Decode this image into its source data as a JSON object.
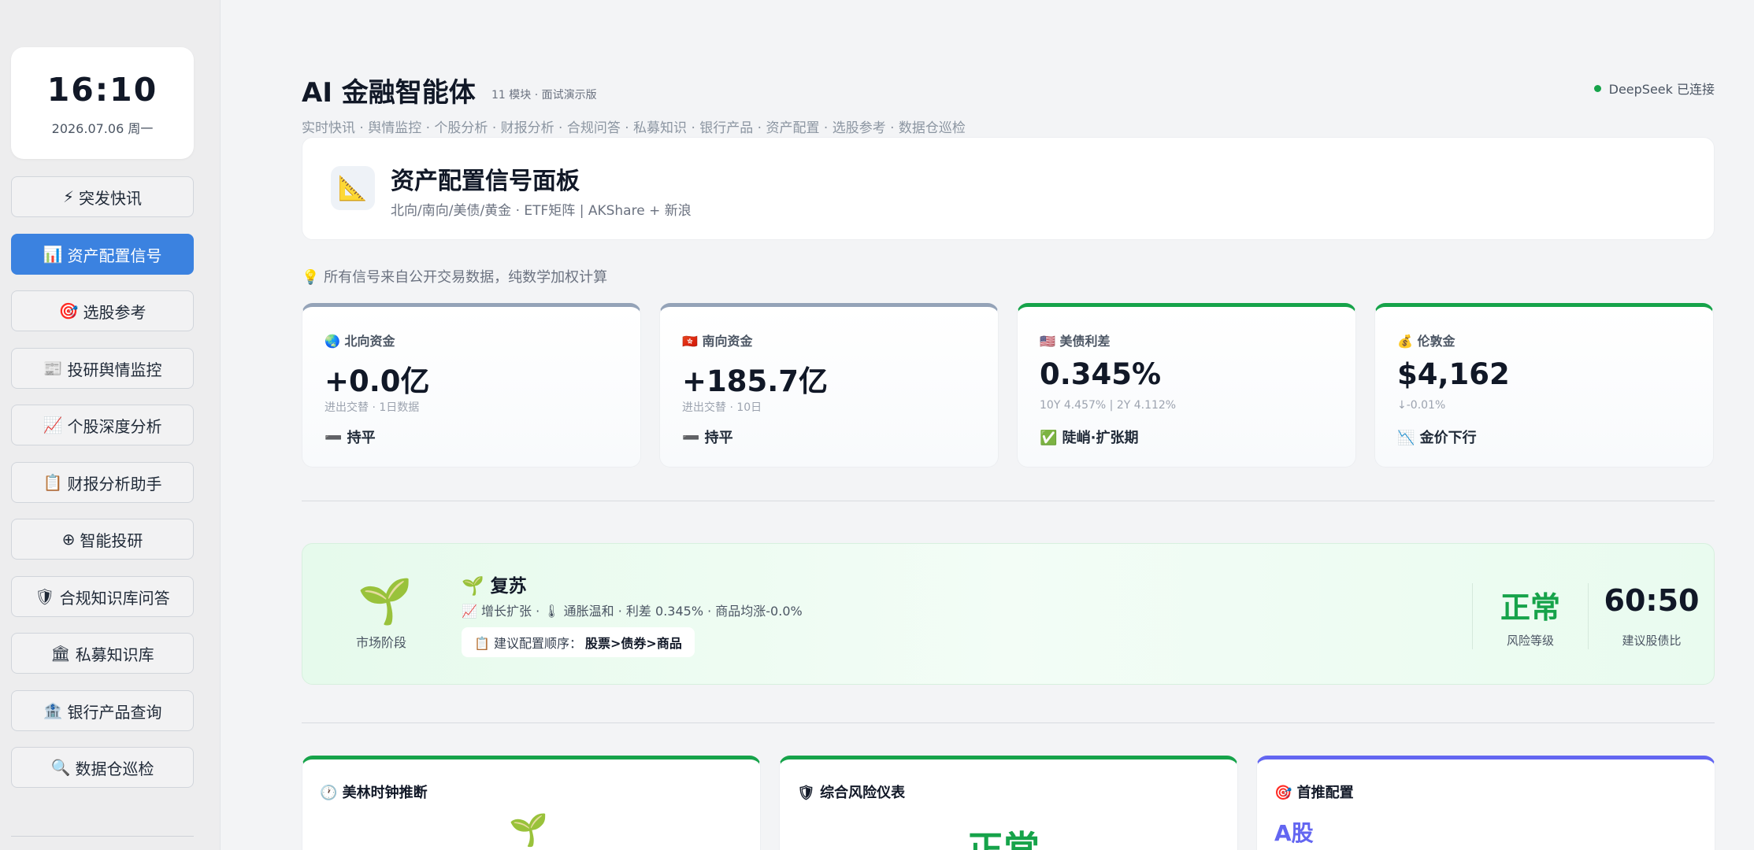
{
  "clock": {
    "time": "16:10",
    "date": "2026.07.06 周一"
  },
  "nav": [
    {
      "icon": "⚡",
      "label": "突发快讯"
    },
    {
      "icon": "📊",
      "label": "资产配置信号"
    },
    {
      "icon": "🎯",
      "label": "选股参考"
    },
    {
      "icon": "📰",
      "label": "投研舆情监控"
    },
    {
      "icon": "📈",
      "label": "个股深度分析"
    },
    {
      "icon": "📋",
      "label": "财报分析助手"
    },
    {
      "icon": "⊕",
      "label": "智能投研"
    },
    {
      "icon": "🛡",
      "label": "合规知识库问答"
    },
    {
      "icon": "🏛",
      "label": "私募知识库"
    },
    {
      "icon": "🏦",
      "label": "银行产品查询"
    },
    {
      "icon": "🔍",
      "label": "数据仓巡检"
    }
  ],
  "header": {
    "title": "AI 金融智能体",
    "badge": "11 模块 · 面试演示版",
    "connection": "DeepSeek 已连接",
    "modules": "实时快讯 · 舆情监控 · 个股分析 · 财报分析 · 合规问答 · 私募知识 · 银行产品 · 资产配置 · 选股参考 · 数据仓巡检"
  },
  "panel": {
    "icon": "📐",
    "title": "资产配置信号面板",
    "subtitle": "北向/南向/美债/黄金 · ETF矩阵 | AKShare + 新浪"
  },
  "note": "💡 所有信号来自公开交易数据，纯数学加权计算",
  "metrics": [
    {
      "icon": "🌏",
      "label": "北向资金",
      "value": "+0.0亿",
      "sub": "进出交替 · 1日数据",
      "status": "➖ 持平"
    },
    {
      "icon": "🇭🇰",
      "label": "南向资金",
      "value": "+185.7亿",
      "sub": "进出交替 · 10日",
      "status": "➖ 持平"
    },
    {
      "icon": "🇺🇸",
      "label": "美债利差",
      "value": "0.345%",
      "sub": "10Y 4.457% | 2Y 4.112%",
      "status": "✅ 陡峭·扩张期"
    },
    {
      "icon": "💰",
      "label": "伦敦金",
      "value": "$4,162",
      "sub": "↓-0.01%",
      "status": "📉 金价下行"
    }
  ],
  "phase": {
    "icon": "🌱",
    "label": "市场阶段",
    "name": "🌱 复苏",
    "desc": "📈 增长扩张 · 🌡 通胀温和 · 利差 0.345% · 商品均涨-0.0%",
    "rec_label": "📋 建议配置顺序：",
    "rec_value": "股票>债券>商品",
    "risk_value": "正常",
    "risk_label": "风险等级",
    "ratio_value": "60:50",
    "ratio_label": "建议股债比"
  },
  "bottom_cards": [
    {
      "title": "🕐 美林时钟推断",
      "preview": "🌱"
    },
    {
      "title": "🛡 综合风险仪表",
      "preview": "正常"
    },
    {
      "title": "🎯 首推配置",
      "preview": "A股"
    }
  ],
  "colors": {
    "accent": "#3b82e0",
    "green": "#16a34a",
    "purple": "#6366f1"
  }
}
